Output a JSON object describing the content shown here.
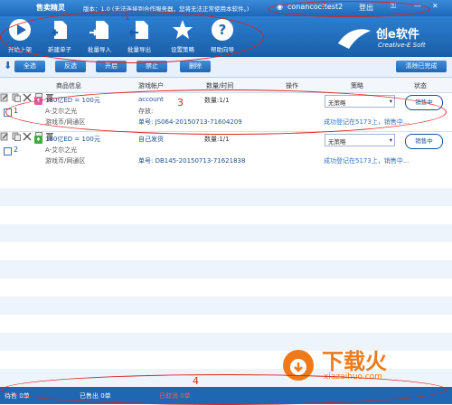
{
  "titlebar": {
    "app_name": "售卖精灵",
    "version_text": "版本：1.0 (无法连接到合作服务器，您将无法正常使用本软件。)",
    "username": "conancooltest2",
    "logout": "登出"
  },
  "toolbar": [
    {
      "label": "开始上架",
      "icon": "play-icon"
    },
    {
      "label": "新建单子",
      "icon": "new-document-icon"
    },
    {
      "label": "批量导入",
      "icon": "import-icon"
    },
    {
      "label": "批量导出",
      "icon": "export-icon"
    },
    {
      "label": "设置策略",
      "icon": "star-settings-icon"
    },
    {
      "label": "帮助向导",
      "icon": "help-icon"
    }
  ],
  "brand": {
    "name": "创e软件",
    "subtitle": "Creative-E Soft"
  },
  "actions": {
    "select_all": "全选",
    "invert": "反选",
    "enable": "开启",
    "disable": "禁止",
    "delete": "删除",
    "clear_done": "清除已完成"
  },
  "columns": [
    "商品信息",
    "游戏帐户",
    "数量/时间",
    "操作",
    "策略",
    "状态"
  ],
  "rows": [
    {
      "index": "1",
      "product": "180亿ED = 100元",
      "server": "A-艾尔之光",
      "area": "游戏币/网通区",
      "account": "account",
      "account_note": "存放:",
      "order": "单号: JS064-20150713-71604209",
      "quantity": "数量:1/1",
      "strategy": "无策略",
      "status": "销售中",
      "message": "成功登记在5173上，销售中...",
      "icon_color": "#e05aa0"
    },
    {
      "index": "2",
      "product": "180亿ED = 100元",
      "server": "A-艾尔之光",
      "area": "游戏币/网通区",
      "account": "自己发货",
      "account_note": "",
      "order": "单号: DB145-20150713-71621838",
      "quantity": "数量:1/1",
      "strategy": "无策略",
      "status": "销售中",
      "message": "成功登记在5173上，销售中...",
      "icon_color": "#3cae3c"
    }
  ],
  "statusbar": {
    "selling": "待售  0单",
    "sold": "已售出  0单",
    "cancelled": "已取消  0单"
  },
  "annotations": [
    "1",
    "2",
    "3",
    "4"
  ],
  "watermark": {
    "text": "下载火",
    "url": "xiazaihuo.com"
  },
  "colors": {
    "primary": "#1f66b3",
    "annotation": "#dd2222",
    "link": "#1b4f94"
  }
}
